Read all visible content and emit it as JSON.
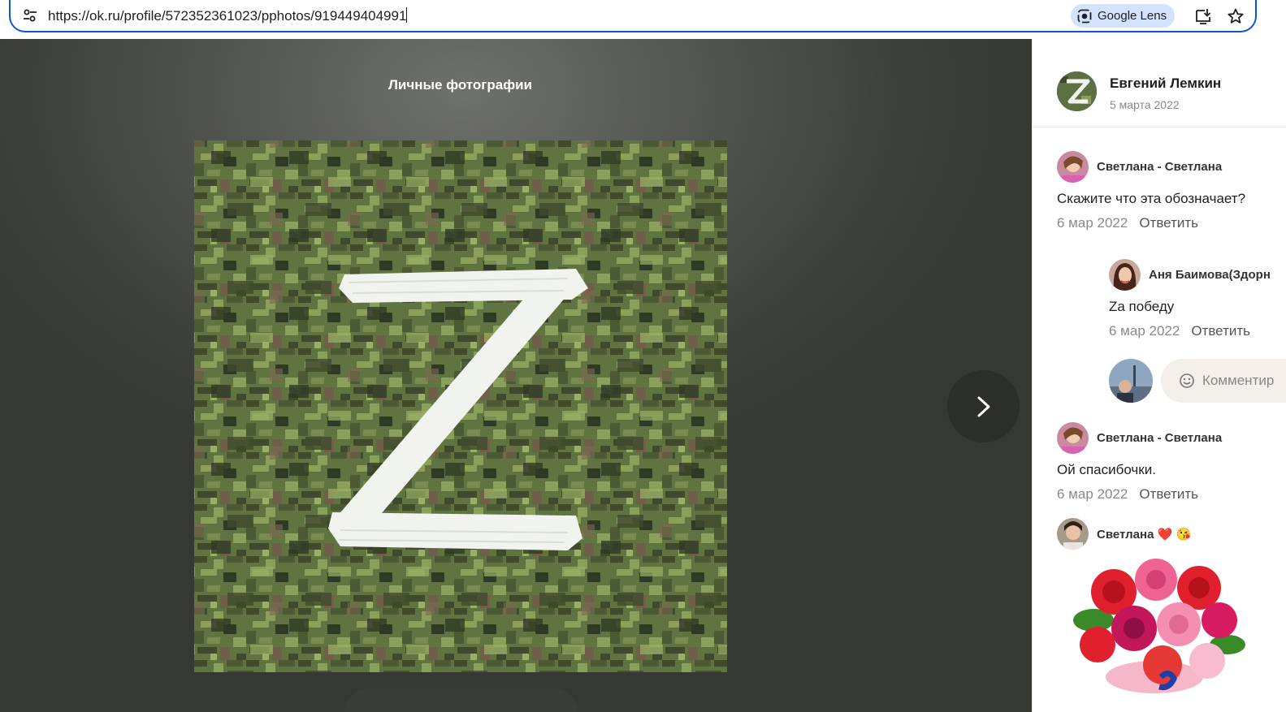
{
  "browser": {
    "url": "https://ok.ru/profile/572352361023/pphotos/919449404991",
    "lens_label": "Google Lens"
  },
  "viewer": {
    "album_title": "Личные фотографии",
    "photo_letter": "Z"
  },
  "post": {
    "author_name": "Евгений Лемкин",
    "date": "5 марта 2022"
  },
  "comments": [
    {
      "name": "Светлана - Светлана",
      "text": "Скажите что эта обозначает?",
      "date": "6 мар 2022",
      "reply": "Ответить"
    },
    {
      "name": "Аня Баимова(Здорн",
      "text": "Zа победу",
      "date": "6 мар 2022",
      "reply": "Ответить"
    },
    {
      "name": "Светлана - Светлана",
      "text": "Ой спасибочки.",
      "date": "6 мар 2022",
      "reply": "Ответить"
    },
    {
      "name": "Светлана",
      "emoji": "❤️ 😘"
    }
  ],
  "compose": {
    "placeholder": "Комментир"
  },
  "colors": {
    "accent": "#0b57d0",
    "lens_bg": "#d3e3fd",
    "camo_dark": "#3e4a2a",
    "camo_light": "#8aa05a"
  }
}
